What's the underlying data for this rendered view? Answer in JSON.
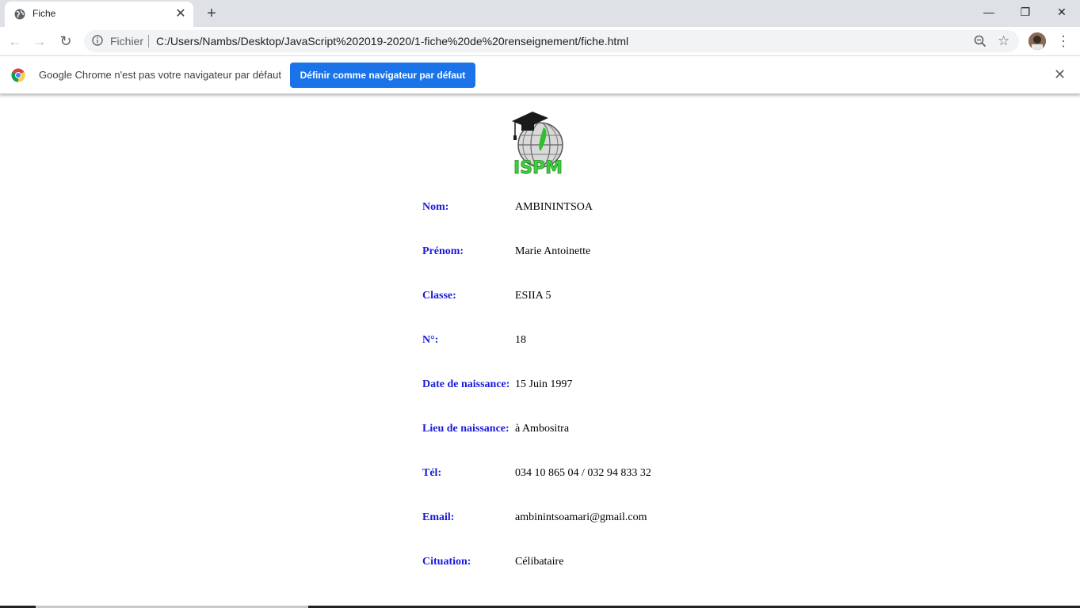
{
  "browser": {
    "tab": {
      "title": "Fiche"
    },
    "omnibox": {
      "scheme": "Fichier",
      "url": "C:/Users/Nambs/Desktop/JavaScript%202019-2020/1-fiche%20de%20renseignement/fiche.html"
    }
  },
  "infobar": {
    "message": "Google Chrome n'est pas votre navigateur par défaut",
    "button": "Définir comme navigateur par défaut"
  },
  "page": {
    "logo_text": "ISPM",
    "fields": [
      {
        "label": "Nom:",
        "value": "AMBININTSOA"
      },
      {
        "label": "Prénom:",
        "value": "Marie Antoinette"
      },
      {
        "label": "Classe:",
        "value": "ESIIA 5"
      },
      {
        "label": "N°:",
        "value": "18"
      },
      {
        "label": "Date de naissance:",
        "value": "15 Juin 1997"
      },
      {
        "label": "Lieu de naissance:",
        "value": "à Ambositra"
      },
      {
        "label": "Tél:",
        "value": "034 10 865 04 / 032 94 833 32"
      },
      {
        "label": "Email:",
        "value": "ambinintsoamari@gmail.com"
      },
      {
        "label": "Cituation:",
        "value": "Célibataire"
      }
    ]
  },
  "colors": {
    "label": "#1a1adc",
    "accent_button": "#1a73e8",
    "tabstrip": "#dee1e6"
  }
}
